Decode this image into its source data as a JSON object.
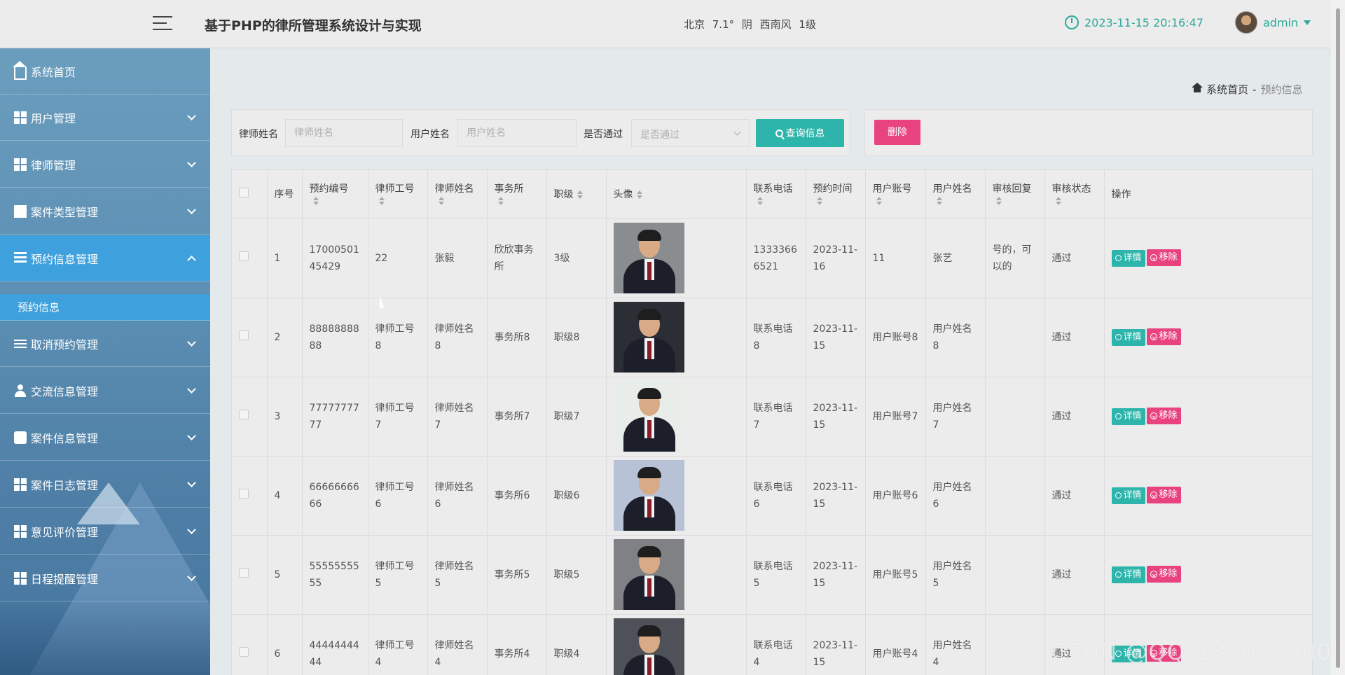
{
  "header": {
    "title": "基于PHP的律所管理系统设计与实现",
    "weather": "北京 7.1° 阴 西南风 1级",
    "datetime": "2023-11-15 20:16:47",
    "username": "admin"
  },
  "sidebar": {
    "items": [
      {
        "label": "系统首页"
      },
      {
        "label": "用户管理"
      },
      {
        "label": "律师管理"
      },
      {
        "label": "案件类型管理"
      },
      {
        "label": "预约信息管理"
      },
      {
        "label": "取消预约管理"
      },
      {
        "label": "交流信息管理"
      },
      {
        "label": "案件信息管理"
      },
      {
        "label": "案件日志管理"
      },
      {
        "label": "意见评价管理"
      },
      {
        "label": "日程提醒管理"
      }
    ],
    "sub_item": "预约信息"
  },
  "breadcrumb": {
    "home": "系统首页",
    "separator": "-",
    "current": "预约信息"
  },
  "filter": {
    "lawyer_name_label": "律师姓名",
    "lawyer_name_placeholder": "律师姓名",
    "user_name_label": "用户姓名",
    "user_name_placeholder": "用户姓名",
    "approved_label": "是否通过",
    "approved_placeholder": "是否通过",
    "query_button": "查询信息",
    "delete_button": "删除"
  },
  "table": {
    "columns": [
      "序号",
      "预约编号",
      "律师工号",
      "律师姓名",
      "事务所",
      "职级",
      "头像",
      "联系电话",
      "预约时间",
      "用户账号",
      "用户姓名",
      "审核回复",
      "审核状态",
      "操作"
    ],
    "detail_label": "详情",
    "remove_label": "移除",
    "rows": [
      {
        "index": "1",
        "booking_no": "1700050145429",
        "lawyer_id": "22",
        "lawyer_name": "张毅",
        "firm": "欣欣事务所",
        "rank": "3级",
        "phone": "13333666521",
        "time": "2023-11-16",
        "account": "11",
        "user_name": "张艺",
        "reply": "号的，可以的",
        "status": "通过",
        "photo_bg": "#8a8d8f"
      },
      {
        "index": "2",
        "booking_no": "8888888888",
        "lawyer_id": "律师工号8",
        "lawyer_name": "律师姓名8",
        "firm": "事务所8",
        "rank": "职级8",
        "phone": "联系电话8",
        "time": "2023-11-15",
        "account": "用户账号8",
        "user_name": "用户姓名8",
        "reply": "",
        "status": "通过",
        "photo_bg": "#2b2f35"
      },
      {
        "index": "3",
        "booking_no": "7777777777",
        "lawyer_id": "律师工号7",
        "lawyer_name": "律师姓名7",
        "firm": "事务所7",
        "rank": "职级7",
        "phone": "联系电话7",
        "time": "2023-11-15",
        "account": "用户账号7",
        "user_name": "用户姓名7",
        "reply": "",
        "status": "通过",
        "photo_bg": "#e8ede9"
      },
      {
        "index": "4",
        "booking_no": "6666666666",
        "lawyer_id": "律师工号6",
        "lawyer_name": "律师姓名6",
        "firm": "事务所6",
        "rank": "职级6",
        "phone": "联系电话6",
        "time": "2023-11-15",
        "account": "用户账号6",
        "user_name": "用户姓名6",
        "reply": "",
        "status": "通过",
        "photo_bg": "#b8c2d6"
      },
      {
        "index": "5",
        "booking_no": "5555555555",
        "lawyer_id": "律师工号5",
        "lawyer_name": "律师姓名5",
        "firm": "事务所5",
        "rank": "职级5",
        "phone": "联系电话5",
        "time": "2023-11-15",
        "account": "用户账号5",
        "user_name": "用户姓名5",
        "reply": "",
        "status": "通过",
        "photo_bg": "#7f8185"
      },
      {
        "index": "6",
        "booking_no": "4444444444",
        "lawyer_id": "律师工号4",
        "lawyer_name": "律师姓名4",
        "firm": "事务所4",
        "rank": "职级4",
        "phone": "联系电话4",
        "time": "2023-11-15",
        "account": "用户账号4",
        "user_name": "用户姓名4",
        "reply": "",
        "status": "通过",
        "photo_bg": "#4e5258"
      }
    ]
  },
  "watermark": "CSDN @QQ_188083800"
}
